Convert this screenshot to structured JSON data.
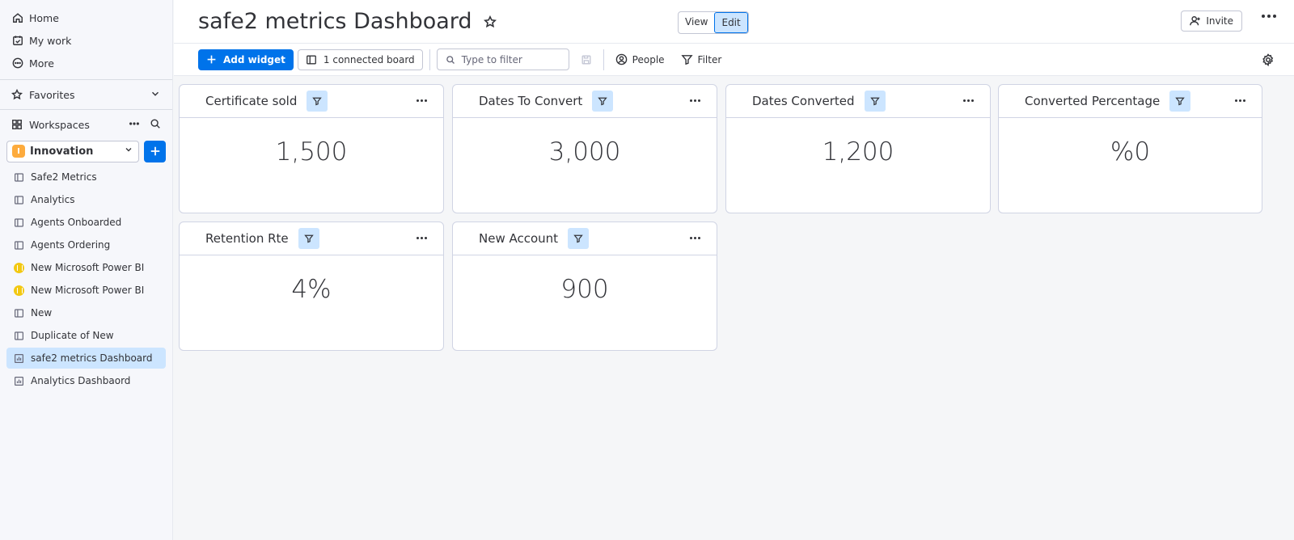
{
  "sidebar": {
    "nav": [
      {
        "label": "Home",
        "icon": "home-icon"
      },
      {
        "label": "My work",
        "icon": "calendar-check-icon"
      },
      {
        "label": "More",
        "icon": "more-circle-icon"
      }
    ],
    "favorites_label": "Favorites",
    "workspaces_label": "Workspaces",
    "workspace": {
      "badge": "I",
      "name": "Innovation",
      "badge_color": "#fdab3d"
    },
    "boards": [
      {
        "label": "Safe2 Metrics",
        "icon": "board-icon",
        "active": false
      },
      {
        "label": "Analytics",
        "icon": "board-icon",
        "active": false
      },
      {
        "label": "Agents Onboarded",
        "icon": "board-icon",
        "active": false
      },
      {
        "label": "Agents Ordering",
        "icon": "board-icon",
        "active": false
      },
      {
        "label": "New Microsoft Power BI",
        "icon": "powerbi-icon",
        "active": false
      },
      {
        "label": "New Microsoft Power BI",
        "icon": "powerbi-icon",
        "active": false
      },
      {
        "label": "New",
        "icon": "board-icon",
        "active": false
      },
      {
        "label": "Duplicate of New",
        "icon": "board-icon",
        "active": false
      },
      {
        "label": "safe2 metrics Dashboard",
        "icon": "dashboard-icon",
        "active": true
      },
      {
        "label": "Analytics Dashbaord",
        "icon": "dashboard-icon",
        "active": false
      }
    ]
  },
  "header": {
    "title": "safe2 metrics Dashboard",
    "view_label": "View",
    "edit_label": "Edit",
    "invite_label": "Invite"
  },
  "toolbar": {
    "add_widget_label": "Add widget",
    "connected_board_label": "1 connected board",
    "search_placeholder": "Type to filter",
    "people_label": "People",
    "filter_label": "Filter"
  },
  "widgets": [
    {
      "title": "Certificate sold",
      "value": "1,500"
    },
    {
      "title": "Dates To Convert",
      "value": "3,000"
    },
    {
      "title": "Dates Converted",
      "value": "1,200"
    },
    {
      "title": "Converted Percentage",
      "value": "%0"
    },
    {
      "title": "Retention Rte",
      "value": "4%"
    },
    {
      "title": "New Account",
      "value": "900"
    }
  ],
  "colors": {
    "accent": "#0073ea",
    "selected_bg": "#cce5ff"
  }
}
